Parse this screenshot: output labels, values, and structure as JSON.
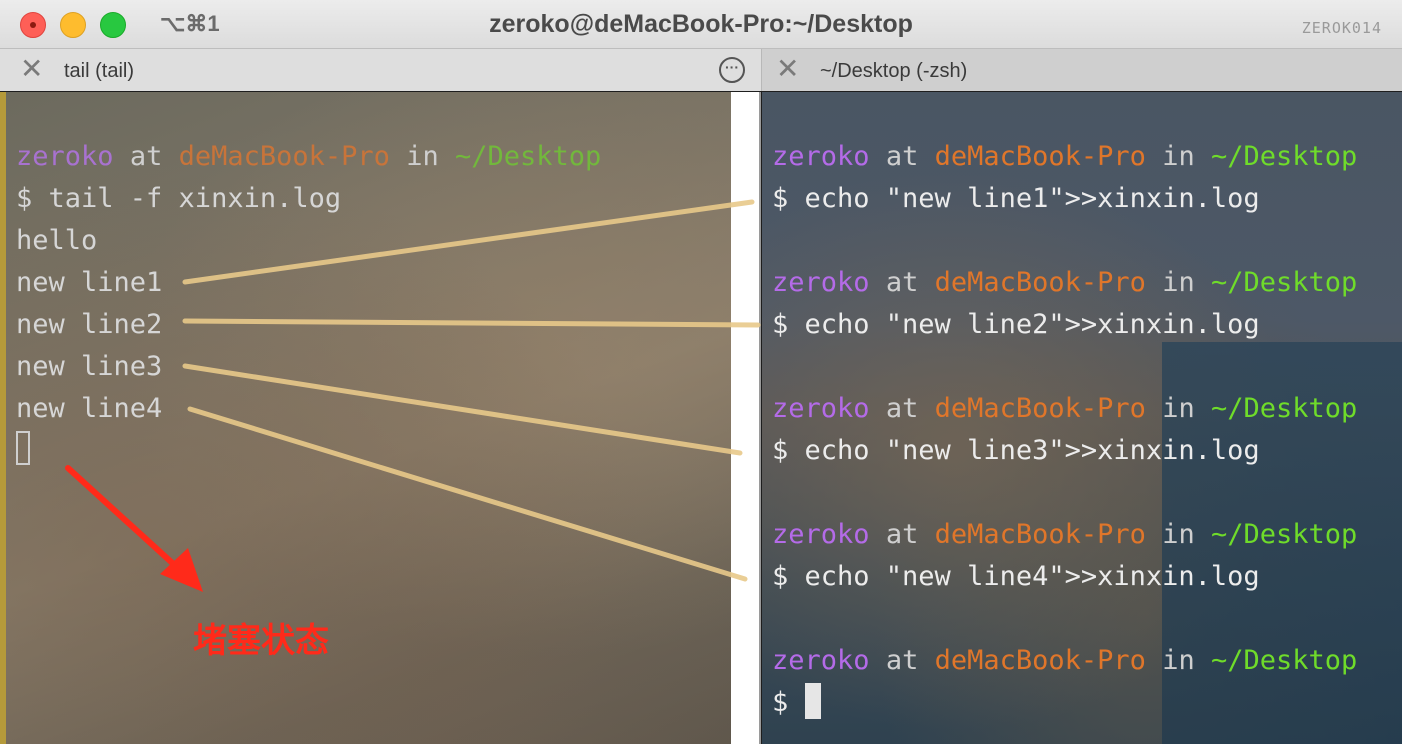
{
  "window": {
    "shortcut": "⌥⌘1",
    "title": "zeroko@deMacBook-Pro:~/Desktop",
    "profile": "ZEROK014"
  },
  "tabs": [
    {
      "label": "tail (tail)",
      "more_icon": "ellipsis-circle-icon"
    },
    {
      "label": "~/Desktop (-zsh)"
    }
  ],
  "prompt": {
    "user": "zeroko",
    "at": "at",
    "host": "deMacBook-Pro",
    "in": "in",
    "path": "~/Desktop"
  },
  "left_pane": {
    "command": "$ tail -f xinxin.log",
    "output": [
      "hello",
      "new line1",
      "new line2",
      "new line3",
      "new line4"
    ]
  },
  "right_pane": {
    "commands": [
      "$ echo \"new line1\">>xinxin.log",
      "$ echo \"new line2\">>xinxin.log",
      "$ echo \"new line3\">>xinxin.log",
      "$ echo \"new line4\">>xinxin.log"
    ],
    "last_prompt": "$"
  },
  "annotation": {
    "label": "堵塞状态",
    "arrow_color": "#ff2a1a",
    "line_color": "#e8c98a"
  },
  "colors": {
    "user": "#b46be8",
    "host": "#e0762a",
    "path": "#6fdc2a"
  }
}
